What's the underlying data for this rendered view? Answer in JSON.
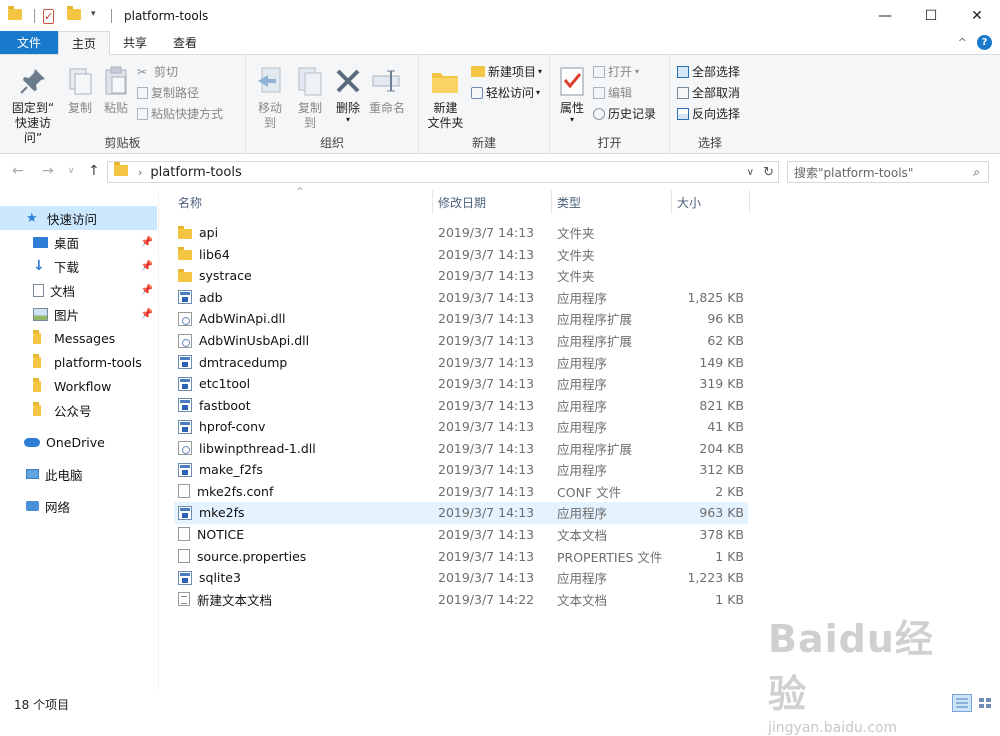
{
  "window": {
    "title": "platform-tools",
    "controls": {
      "minimize": "—",
      "maximize": "☐",
      "close": "✕"
    }
  },
  "ribbon_tabs": [
    "文件",
    "主页",
    "共享",
    "查看"
  ],
  "ribbon": {
    "clipboard": {
      "label": "剪贴板",
      "pin_quick_access": [
        "固定到“",
        "快速访问”"
      ],
      "copy": "复制",
      "paste": "粘贴",
      "cut": "剪切",
      "copy_path": "复制路径",
      "paste_shortcut": "粘贴快捷方式"
    },
    "organize": {
      "label": "组织",
      "move_to": "移动到",
      "copy_to": "复制到",
      "delete": "删除",
      "rename": "重命名"
    },
    "new": {
      "label": "新建",
      "new_folder": [
        "新建",
        "文件夹"
      ],
      "new_item": "新建项目",
      "easy_access": "轻松访问"
    },
    "open": {
      "label": "打开",
      "properties": "属性",
      "open": "打开",
      "edit": "编辑",
      "history": "历史记录"
    },
    "select": {
      "label": "选择",
      "select_all": "全部选择",
      "select_none": "全部取消",
      "invert": "反向选择"
    }
  },
  "address": {
    "path": "platform-tools",
    "search_placeholder": "搜索\"platform-tools\""
  },
  "nav_pane": [
    {
      "label": "快速访问",
      "icon": "star-icon",
      "selected": true,
      "pinned": false
    },
    {
      "label": "桌面",
      "icon": "desktop-icon",
      "pinned": true
    },
    {
      "label": "下载",
      "icon": "download-icon",
      "pinned": true
    },
    {
      "label": "文档",
      "icon": "document-icon",
      "pinned": true
    },
    {
      "label": "图片",
      "icon": "picture-icon",
      "pinned": true
    },
    {
      "label": "Messages",
      "icon": "folder-icon",
      "pinned": false
    },
    {
      "label": "platform-tools",
      "icon": "folder-icon",
      "pinned": false
    },
    {
      "label": "Workflow",
      "icon": "folder-icon",
      "pinned": false
    },
    {
      "label": "公众号",
      "icon": "folder-icon",
      "pinned": false
    },
    {
      "label": "OneDrive",
      "icon": "cloud-icon",
      "pinned": false
    },
    {
      "label": "此电脑",
      "icon": "computer-icon",
      "pinned": false
    },
    {
      "label": "网络",
      "icon": "network-icon",
      "pinned": false
    }
  ],
  "columns": {
    "name": "名称",
    "date": "修改日期",
    "type": "类型",
    "size": "大小"
  },
  "files": [
    {
      "name": "api",
      "date": "2019/3/7 14:13",
      "type": "文件夹",
      "size": "",
      "icon": "folder"
    },
    {
      "name": "lib64",
      "date": "2019/3/7 14:13",
      "type": "文件夹",
      "size": "",
      "icon": "folder"
    },
    {
      "name": "systrace",
      "date": "2019/3/7 14:13",
      "type": "文件夹",
      "size": "",
      "icon": "folder"
    },
    {
      "name": "adb",
      "date": "2019/3/7 14:13",
      "type": "应用程序",
      "size": "1,825 KB",
      "icon": "app"
    },
    {
      "name": "AdbWinApi.dll",
      "date": "2019/3/7 14:13",
      "type": "应用程序扩展",
      "size": "96 KB",
      "icon": "dll"
    },
    {
      "name": "AdbWinUsbApi.dll",
      "date": "2019/3/7 14:13",
      "type": "应用程序扩展",
      "size": "62 KB",
      "icon": "dll"
    },
    {
      "name": "dmtracedump",
      "date": "2019/3/7 14:13",
      "type": "应用程序",
      "size": "149 KB",
      "icon": "app"
    },
    {
      "name": "etc1tool",
      "date": "2019/3/7 14:13",
      "type": "应用程序",
      "size": "319 KB",
      "icon": "app"
    },
    {
      "name": "fastboot",
      "date": "2019/3/7 14:13",
      "type": "应用程序",
      "size": "821 KB",
      "icon": "app"
    },
    {
      "name": "hprof-conv",
      "date": "2019/3/7 14:13",
      "type": "应用程序",
      "size": "41 KB",
      "icon": "app"
    },
    {
      "name": "libwinpthread-1.dll",
      "date": "2019/3/7 14:13",
      "type": "应用程序扩展",
      "size": "204 KB",
      "icon": "dll"
    },
    {
      "name": "make_f2fs",
      "date": "2019/3/7 14:13",
      "type": "应用程序",
      "size": "312 KB",
      "icon": "app"
    },
    {
      "name": "mke2fs.conf",
      "date": "2019/3/7 14:13",
      "type": "CONF 文件",
      "size": "2 KB",
      "icon": "doc"
    },
    {
      "name": "mke2fs",
      "date": "2019/3/7 14:13",
      "type": "应用程序",
      "size": "963 KB",
      "icon": "app",
      "hover": true
    },
    {
      "name": "NOTICE",
      "date": "2019/3/7 14:13",
      "type": "文本文档",
      "size": "378 KB",
      "icon": "doc"
    },
    {
      "name": "source.properties",
      "date": "2019/3/7 14:13",
      "type": "PROPERTIES 文件",
      "size": "1 KB",
      "icon": "doc"
    },
    {
      "name": "sqlite3",
      "date": "2019/3/7 14:13",
      "type": "应用程序",
      "size": "1,223 KB",
      "icon": "app"
    },
    {
      "name": "新建文本文档",
      "date": "2019/3/7 14:22",
      "type": "文本文档",
      "size": "1 KB",
      "icon": "txt"
    }
  ],
  "status": {
    "count": "18 个项目"
  },
  "watermark": {
    "logo": "Baidu经验",
    "url": "jingyan.baidu.com"
  },
  "colors": {
    "accent": "#1979ca",
    "selection": "#cce8ff",
    "hover_row": "#e5f3ff"
  }
}
